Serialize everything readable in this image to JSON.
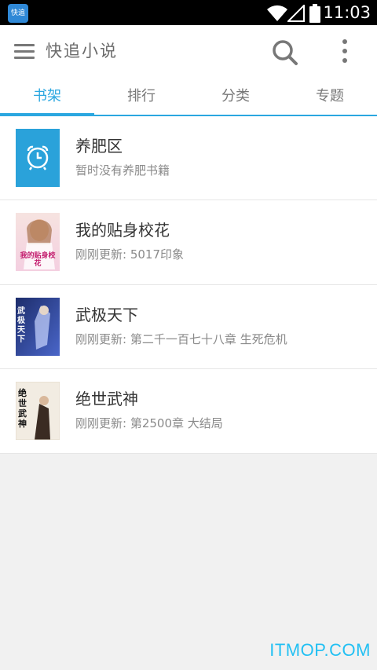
{
  "status_bar": {
    "app_icon_label": "快追",
    "time": "11:03",
    "icons": [
      "wifi-icon",
      "signal-icon",
      "battery-icon"
    ]
  },
  "app_bar": {
    "title": "快追小说",
    "icons": [
      "menu-icon",
      "search-icon",
      "more-vert-icon"
    ]
  },
  "tabs": [
    {
      "label": "书架",
      "active": true
    },
    {
      "label": "排行",
      "active": false
    },
    {
      "label": "分类",
      "active": false
    },
    {
      "label": "专题",
      "active": false
    }
  ],
  "books": [
    {
      "title": "养肥区",
      "subtitle": "暂时没有养肥书籍",
      "cover": "alarm-clock-icon"
    },
    {
      "title": "我的贴身校花",
      "subtitle": "刚刚更新: 5017印象",
      "cover": "book-cover",
      "cover_text": "我的贴身校花"
    },
    {
      "title": "武极天下",
      "subtitle": "刚刚更新: 第二千一百七十八章 生死危机",
      "cover": "book-cover",
      "cover_text": "武极天下"
    },
    {
      "title": "绝世武神",
      "subtitle": "刚刚更新: 第2500章 大结局",
      "cover": "book-cover",
      "cover_text": "绝世武神"
    }
  ],
  "watermark": "ITMOP.COM",
  "colors": {
    "accent": "#2aa7e0",
    "status_bar": "#000000",
    "background": "#f1f1f1",
    "watermark": "#22c0f3"
  }
}
